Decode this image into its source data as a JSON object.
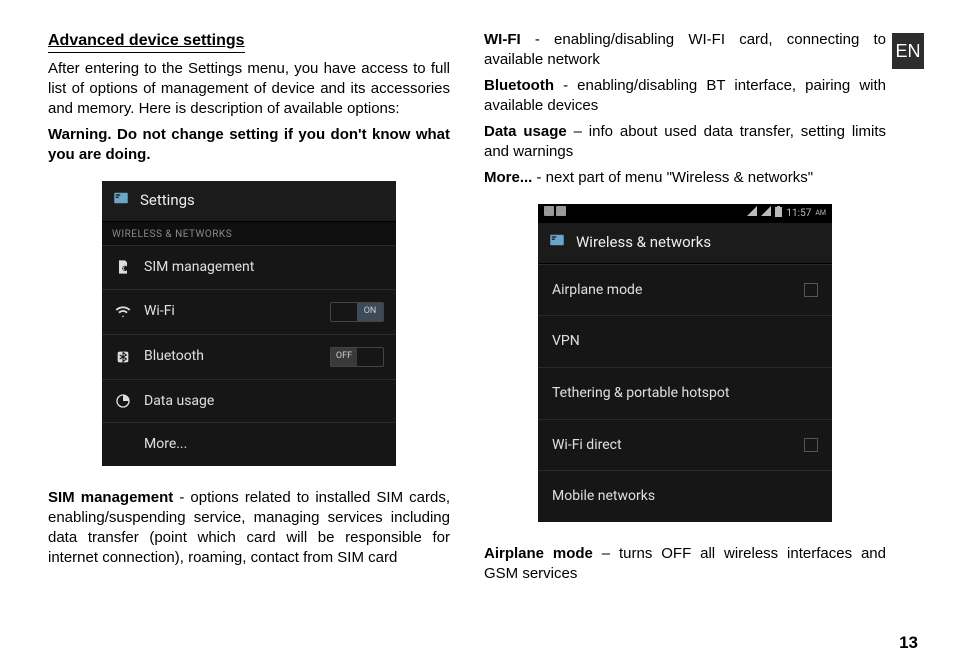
{
  "lang_tab": "EN",
  "page_number": "13",
  "left": {
    "heading": " Advanced device settings ",
    "intro": "After entering to the Settings menu, you have access to full list of options of management of device and its accessories and memory. Here is description of available options:",
    "warning": "Warning. Do not change setting if you don't know what you are doing.",
    "sim_bold": "SIM management",
    "sim_text": " - options related to installed SIM cards, enabling/suspending service, managing services including data transfer (point which card will be responsible for internet connection), roaming, contact from SIM card"
  },
  "right": {
    "wifi_bold": "WI-FI",
    "wifi_text": " - enabling/disabling WI-FI card, connecting to available network",
    "bt_bold": "Bluetooth",
    "bt_text": " - enabling/disabling BT interface, pairing with available devices",
    "data_bold": "Data usage",
    "data_text": " – info about used data transfer, setting limits and warnings",
    "more_bold": "More...",
    "more_text": " - next part of menu \"Wireless & networks\"",
    "airplane_bold": "Airplane mode",
    "airplane_text": " – turns OFF all wireless interfaces and GSM services"
  },
  "phone1": {
    "title": "Settings",
    "section": "WIRELESS & NETWORKS",
    "rows": {
      "sim": "SIM management",
      "wifi": "Wi-Fi",
      "wifi_toggle": "ON",
      "bt": "Bluetooth",
      "bt_toggle": "OFF",
      "data": "Data usage",
      "more": "More..."
    }
  },
  "phone2": {
    "status_time": "11:57",
    "status_ampm": "AM",
    "title": "Wireless & networks",
    "rows": {
      "airplane": "Airplane mode",
      "vpn": "VPN",
      "tether": "Tethering & portable hotspot",
      "wifidirect": "Wi-Fi direct",
      "mobile": "Mobile networks"
    }
  }
}
